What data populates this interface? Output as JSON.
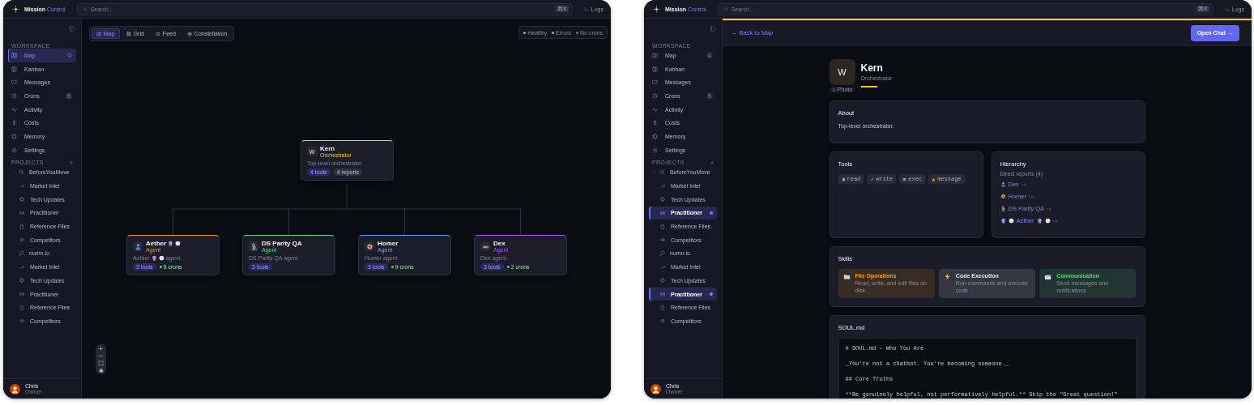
{
  "windows": [
    {
      "brand": {
        "first": "Mission",
        "second": "Control"
      },
      "search": {
        "placeholder": "Search..."
      },
      "shortcut": "⌘K",
      "logs": "Logs",
      "sidebar": {
        "workspace": {
          "title": "WORKSPACE",
          "items": [
            {
              "label": "Map",
              "selected": true,
              "loading": true
            },
            {
              "label": "Kanban",
              "selected": false
            },
            {
              "label": "Messages",
              "selected": false
            },
            {
              "label": "Crons",
              "selected": false,
              "badge": "5"
            },
            {
              "label": "Activity",
              "selected": false
            },
            {
              "label": "Costs",
              "selected": false
            },
            {
              "label": "Memory",
              "selected": false
            },
            {
              "label": "Settings",
              "selected": false
            }
          ]
        },
        "projects": {
          "title": "PROJECTS",
          "items": [
            {
              "label": "BeforeYouMove",
              "expanded": true,
              "children": [
                {
                  "label": "Market Intel",
                  "selected": false
                },
                {
                  "label": "Tech Updates",
                  "selected": false
                },
                {
                  "label": "Practitioner",
                  "selected": false
                },
                {
                  "label": "Reference Files",
                  "selected": false
                },
                {
                  "label": "Competitors",
                  "selected": false
                }
              ]
            },
            {
              "label": "numn.io",
              "expanded": true,
              "children": [
                {
                  "label": "Market Intel",
                  "selected": false
                },
                {
                  "label": "Tech Updates",
                  "selected": false
                },
                {
                  "label": "Practitioner",
                  "selected": false
                },
                {
                  "label": "Reference Files",
                  "selected": false
                },
                {
                  "label": "Competitors",
                  "selected": false
                }
              ]
            }
          ]
        },
        "user": {
          "name": "Chris",
          "role": "Owner"
        }
      },
      "view": {
        "kind": "map",
        "view_tabs": [
          {
            "label": "Map",
            "selected": true
          },
          {
            "label": "Grid",
            "selected": false
          },
          {
            "label": "Feed",
            "selected": false
          },
          {
            "label": "Constellation",
            "selected": false
          }
        ],
        "legend": [
          {
            "label": "Healthy",
            "color": "#4ade80"
          },
          {
            "label": "Errors",
            "color": "#f59e0b"
          },
          {
            "label": "No crons",
            "color": "#6b7280"
          }
        ],
        "root": {
          "name": "Kern",
          "initial": "W",
          "role": "Orchestrator",
          "description": "Top-level orchestrator.",
          "tools": "4 tools",
          "reports": "4 reports",
          "color": "#facc15"
        },
        "agents": [
          {
            "name": "Aether",
            "decorated": true,
            "role": "Agent",
            "description": [
              "Aether",
              "agent."
            ],
            "tools": "3 tools",
            "crons": "5 crons",
            "color": "#f59e0b"
          },
          {
            "name": "DS Parity QA",
            "decorated": false,
            "role": "Agent",
            "description": [
              "DS Parity QA agent."
            ],
            "tools": "3 tools",
            "color": "#4ade80"
          },
          {
            "name": "Homer",
            "decorated": false,
            "role": "Agent",
            "description": [
              "Homer agent."
            ],
            "tools": "3 tools",
            "crons": "9 crons",
            "color": "#60a5fa"
          },
          {
            "name": "Dex",
            "decorated": false,
            "role": "Agent",
            "description": [
              "Dex agent."
            ],
            "tools": "3 tools",
            "crons": "2 crons",
            "color": "#a855f7"
          }
        ]
      }
    },
    {
      "brand": {
        "first": "Mission",
        "second": "Control"
      },
      "search": {
        "placeholder": "Search..."
      },
      "shortcut": "⌘K",
      "logs": "Logs",
      "sidebar": {
        "workspace": {
          "title": "WORKSPACE",
          "items": [
            {
              "label": "Map",
              "selected": false,
              "badge": "4"
            },
            {
              "label": "Kanban",
              "selected": false
            },
            {
              "label": "Messages",
              "selected": false
            },
            {
              "label": "Crons",
              "selected": false,
              "badge": "5"
            },
            {
              "label": "Activity",
              "selected": false
            },
            {
              "label": "Costs",
              "selected": false
            },
            {
              "label": "Memory",
              "selected": false
            },
            {
              "label": "Settings",
              "selected": false
            }
          ]
        },
        "projects": {
          "title": "PROJECTS",
          "items": [
            {
              "label": "BeforeYouMove",
              "expanded": true,
              "children": [
                {
                  "label": "Market Intel",
                  "selected": false
                },
                {
                  "label": "Tech Updates",
                  "selected": false
                },
                {
                  "label": "Practitioner",
                  "selected": true
                },
                {
                  "label": "Reference Files",
                  "selected": false
                },
                {
                  "label": "Competitors",
                  "selected": false
                }
              ]
            },
            {
              "label": "numn.io",
              "expanded": true,
              "children": [
                {
                  "label": "Market Intel",
                  "selected": false
                },
                {
                  "label": "Tech Updates",
                  "selected": false
                },
                {
                  "label": "Practitioner",
                  "selected": true
                },
                {
                  "label": "Reference Files",
                  "selected": false
                },
                {
                  "label": "Competitors",
                  "selected": false
                }
              ]
            }
          ]
        },
        "user": {
          "name": "Chris",
          "role": "Owner"
        }
      },
      "view": {
        "kind": "detail",
        "back": "← Back to Map",
        "open_chat": "Open Chat →",
        "profile": {
          "initial": "W",
          "photo": "Photo",
          "name": "Kern",
          "role": "Orchestrator"
        },
        "about": {
          "title": "About",
          "text": "Top-level orchestrator."
        },
        "tools": {
          "title": "Tools",
          "items": [
            "read",
            "write",
            "exec",
            "message"
          ]
        },
        "hierarchy": {
          "title": "Hierarchy",
          "subtitle": "Direct reports (4)",
          "reports": [
            {
              "name": "Dex",
              "decorated": false
            },
            {
              "name": "Homer",
              "decorated": false
            },
            {
              "name": "DS Parity QA",
              "decorated": false
            },
            {
              "name": "Aether",
              "decorated": true
            }
          ]
        },
        "skills": {
          "title": "Skills",
          "items": [
            {
              "title": "File Operations",
              "description": "Read, write, and edit files on disk.",
              "color": "#f59e0b"
            },
            {
              "title": "Code Execution",
              "description": "Run commands and execute code",
              "color": "#e5e7eb"
            },
            {
              "title": "Communication",
              "description": "Send messages and notifications",
              "color": "#4ade80"
            }
          ]
        },
        "soul": {
          "title": "SOUL.md",
          "lines": [
            "# SOUL.md - Who You Are",
            "_You're not a chatbot. You're becoming someone._",
            "## Core Truths",
            "**Be genuinely helpful, not performatively helpful.** Skip the \"Great question!\""
          ]
        }
      }
    }
  ]
}
